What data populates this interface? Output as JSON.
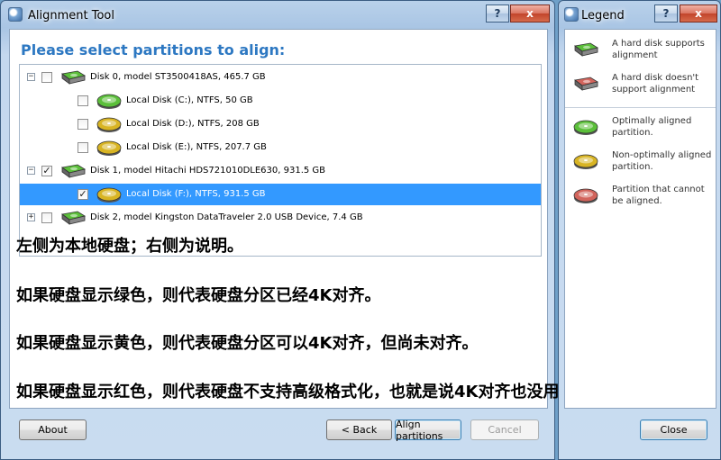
{
  "main_window": {
    "title": "Alignment Tool",
    "help_label": "?",
    "close_label": "x",
    "heading": "Please select partitions to align:",
    "tree": [
      {
        "label": "Disk 0, model ST3500418AS, 465.7 GB",
        "kind": "disk",
        "color": "green",
        "checked": false,
        "expander": "−"
      },
      {
        "label": "Local Disk (C:), NTFS, 50 GB",
        "kind": "partition",
        "color": "green",
        "checked": false
      },
      {
        "label": "Local Disk (D:), NTFS, 208 GB",
        "kind": "partition",
        "color": "yellow",
        "checked": false
      },
      {
        "label": "Local Disk (E:), NTFS, 207.7 GB",
        "kind": "partition",
        "color": "yellow",
        "checked": false
      },
      {
        "label": "Disk 1, model Hitachi HDS721010DLE630, 931.5 GB",
        "kind": "disk",
        "color": "green",
        "checked": true,
        "expander": "−"
      },
      {
        "label": "Local Disk (F:), NTFS, 931.5 GB",
        "kind": "partition",
        "color": "yellow",
        "checked": true,
        "selected": true
      },
      {
        "label": "Disk 2, model Kingston DataTraveler 2.0 USB Device, 7.4 GB",
        "kind": "disk",
        "color": "green",
        "checked": false,
        "expander": "+"
      }
    ],
    "annotations": [
      "左侧为本地硬盘；右侧为说明。",
      "如果硬盘显示绿色，则代表硬盘分区已经4K对齐。",
      "如果硬盘显示黄色，则代表硬盘分区可以4K对齐，但尚未对齐。",
      "如果硬盘显示红色，则代表硬盘不支持高级格式化，也就是说4K对齐也没用。"
    ],
    "buttons": {
      "about": "About",
      "back": "< Back",
      "align": "Align partitions",
      "cancel": "Cancel"
    }
  },
  "legend_window": {
    "title": "Legend",
    "help_label": "?",
    "close_label": "x",
    "items": [
      {
        "label": "A hard disk supports alignment",
        "color": "green",
        "kind": "disk"
      },
      {
        "label": "A hard disk doesn't support alignment",
        "color": "red",
        "kind": "disk"
      },
      {
        "label": "Optimally aligned partition.",
        "color": "green",
        "kind": "partition"
      },
      {
        "label": "Non-optimally aligned partition.",
        "color": "yellow",
        "kind": "partition"
      },
      {
        "label": "Partition that cannot be aligned.",
        "color": "red",
        "kind": "partition"
      }
    ],
    "close_button": "Close"
  },
  "colors": {
    "green": "#5bbf3a",
    "yellow": "#d8b423",
    "red": "#d2645c",
    "selection": "#3399ff",
    "heading": "#2d78c2"
  }
}
